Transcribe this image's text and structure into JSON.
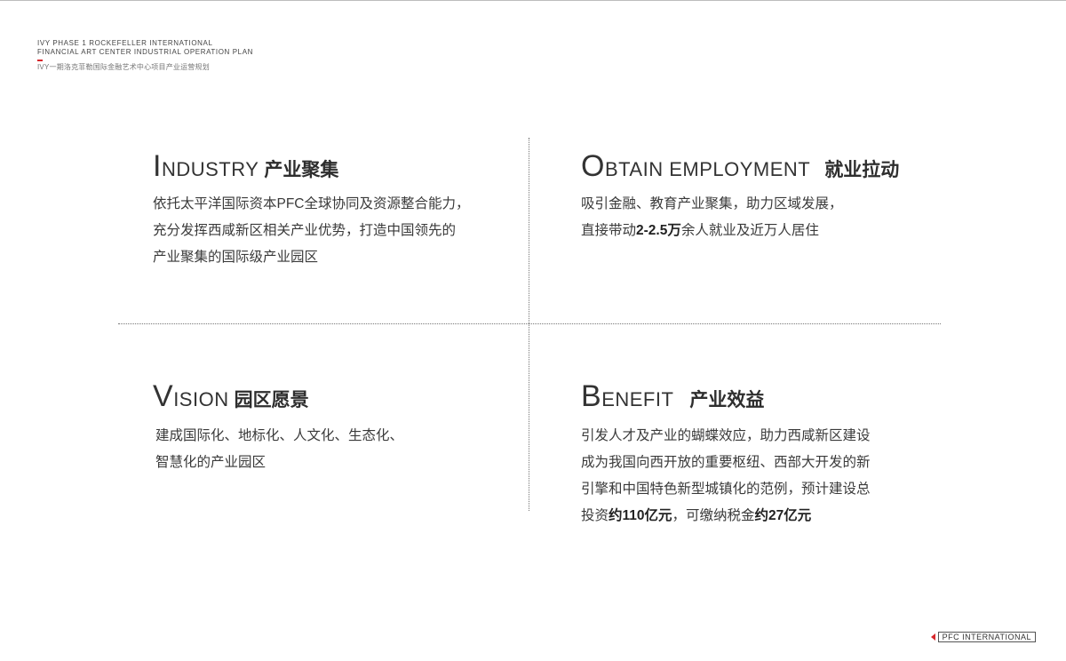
{
  "header": {
    "line1": "IVY PHASE 1 ROCKEFELLER INTERNATIONAL",
    "line2": "FINANCIAL ART  CENTER INDUSTRIAL OPERATION PLAN",
    "line3": "IVY一期洛克菲勒国际金融艺术中心项目产业运营规划"
  },
  "sections": {
    "industry": {
      "cap": "I",
      "rest": "NDUSTRY",
      "cn": "产业聚集",
      "lines": [
        "依托太平洋国际资本PFC全球协同及资源整合能力，",
        "充分发挥西咸新区相关产业优势，打造中国领先的",
        "产业聚集的国际级产业园区"
      ]
    },
    "employment": {
      "cap": "O",
      "rest": "BTAIN EMPLOYMENT",
      "cn": "就业拉动",
      "line1": "吸引金融、教育产业聚集，助力区域发展，",
      "line2_a": "直接带动",
      "line2_b": "2-2.5万",
      "line2_c": "余人就业及近万人居住"
    },
    "vision": {
      "cap": "V",
      "rest": "ISION",
      "cn": "园区愿景",
      "lines": [
        "建成国际化、地标化、人文化、生态化、",
        "智慧化的产业园区"
      ]
    },
    "benefit": {
      "cap": "B",
      "rest": "ENEFIT",
      "cn": "产业效益",
      "lines": [
        "引发人才及产业的蝴蝶效应，助力西咸新区建设",
        "成为我国向西开放的重要枢纽、西部大开发的新",
        "引擎和中国特色新型城镇化的范例，预计建设总"
      ],
      "last_a": "投资",
      "last_b": "约110亿元",
      "last_c": "，可缴纳税金",
      "last_d": "约27亿元"
    }
  },
  "footer": {
    "label": "PFC INTERNATIONAL"
  },
  "colors": {
    "accent": "#d8282c",
    "text": "#3a3a3a",
    "rule": "#777777"
  }
}
